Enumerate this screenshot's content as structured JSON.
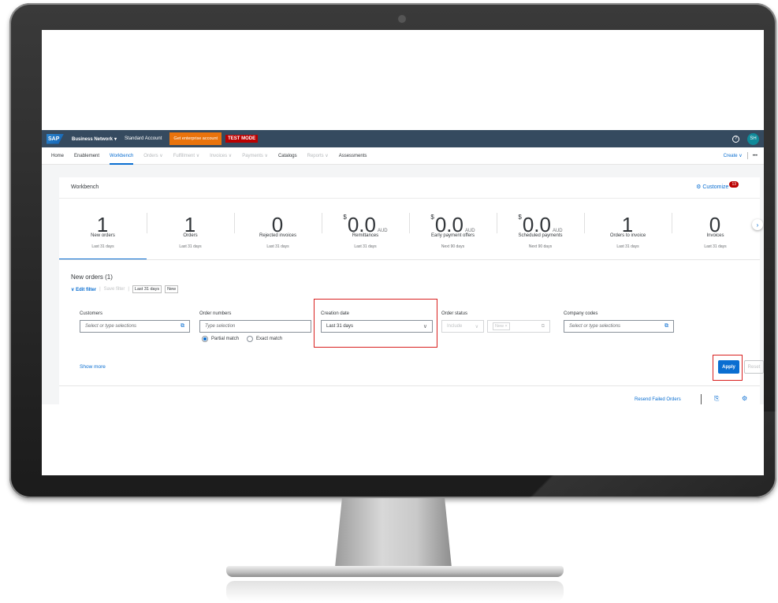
{
  "shell": {
    "logo": "SAP",
    "product": "Business Network",
    "account": "Standard Account",
    "enterprise_button": "Get enterprise account",
    "test_mode": "TEST MODE",
    "help": "?",
    "avatar_initials": "SH",
    "colors": {
      "shell_bg": "#354a5f",
      "enterprise_bg": "#e9730c",
      "test_mode_bg": "#bb0000",
      "avatar_bg": "#0f8a9a"
    }
  },
  "nav": {
    "items": [
      {
        "label": "Home",
        "state": "normal"
      },
      {
        "label": "Enablement",
        "state": "normal"
      },
      {
        "label": "Workbench",
        "state": "active"
      },
      {
        "label": "Orders ∨",
        "state": "disabled"
      },
      {
        "label": "Fulfillment ∨",
        "state": "disabled"
      },
      {
        "label": "Invoices ∨",
        "state": "disabled"
      },
      {
        "label": "Payments ∨",
        "state": "disabled"
      },
      {
        "label": "Catalogs",
        "state": "normal"
      },
      {
        "label": "Reports ∨",
        "state": "disabled"
      },
      {
        "label": "Assessments",
        "state": "normal"
      }
    ],
    "create_label": "Create ∨",
    "more": "•••",
    "accent_color": "#0a6ed1"
  },
  "workbench": {
    "title": "Workbench",
    "customize_label": "Customize",
    "customize_badge": "13",
    "tiles": [
      {
        "value": "1",
        "currency": "",
        "unit": "",
        "label": "New orders",
        "period": "Last 31 days",
        "selected": true
      },
      {
        "value": "1",
        "currency": "",
        "unit": "",
        "label": "Orders",
        "period": "Last 31 days",
        "selected": false
      },
      {
        "value": "0",
        "currency": "",
        "unit": "",
        "label": "Rejected invoices",
        "period": "Last 31 days",
        "selected": false
      },
      {
        "value": "0.0",
        "currency": "$",
        "unit": "AUD",
        "label": "Remittances",
        "period": "Last 31 days",
        "selected": false
      },
      {
        "value": "0.0",
        "currency": "$",
        "unit": "AUD",
        "label": "Early payment offers",
        "period": "Next 90 days",
        "selected": false
      },
      {
        "value": "0.0",
        "currency": "$",
        "unit": "AUD",
        "label": "Scheduled payments",
        "period": "Next 90 days",
        "selected": false
      },
      {
        "value": "1",
        "currency": "",
        "unit": "",
        "label": "Orders to invoice",
        "period": "Last 31 days",
        "selected": false
      },
      {
        "value": "0",
        "currency": "",
        "unit": "",
        "label": "Invoices",
        "period": "Last 31 days",
        "selected": false
      }
    ]
  },
  "orders": {
    "title": "New orders (1)",
    "edit_filter": "Edit filter",
    "save_filter": "Save filter",
    "chips": [
      "Last 31 days",
      "New"
    ],
    "filters": {
      "customers": {
        "label": "Customers",
        "placeholder": "Select or type selections"
      },
      "order_numbers": {
        "label": "Order numbers",
        "placeholder": "Type selection",
        "partial_match": "Partial match",
        "exact_match": "Exact match"
      },
      "creation_date": {
        "label": "Creation date",
        "value": "Last 31 days"
      },
      "order_status": {
        "label": "Order status",
        "include": "Include",
        "token": "New ×"
      },
      "company_codes": {
        "label": "Company codes",
        "placeholder": "Select or type selections"
      }
    },
    "show_more": "Show more",
    "apply": "Apply",
    "reset": "Reset",
    "resend_failed": "Resend Failed Orders",
    "highlight_color": "#d9201f"
  }
}
